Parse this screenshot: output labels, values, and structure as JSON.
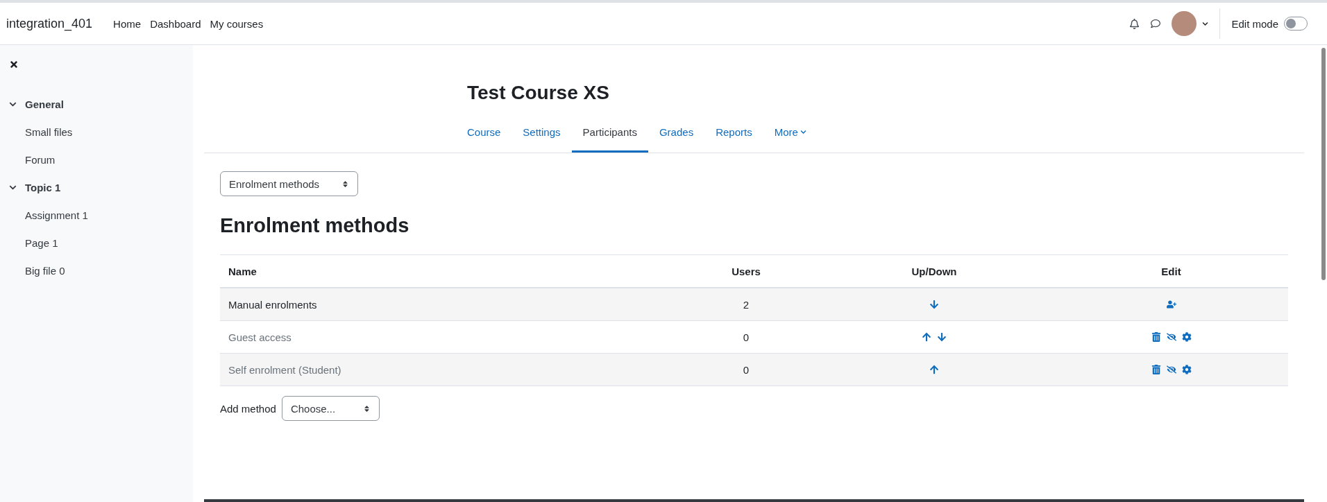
{
  "navbar": {
    "brand": "integration_401",
    "links": [
      "Home",
      "Dashboard",
      "My courses"
    ],
    "edit_mode": {
      "label": "Edit mode",
      "on": false
    }
  },
  "sidebar": {
    "sections": [
      {
        "title": "General",
        "expanded": true,
        "children": [
          {
            "label": "Small files"
          },
          {
            "label": "Forum"
          }
        ]
      },
      {
        "title": "Topic 1",
        "expanded": true,
        "children": [
          {
            "label": "Assignment 1"
          },
          {
            "label": "Page 1"
          },
          {
            "label": "Big file 0"
          }
        ]
      }
    ]
  },
  "course": {
    "title": "Test Course XS",
    "tabs": [
      {
        "label": "Course",
        "selected": false
      },
      {
        "label": "Settings",
        "selected": false
      },
      {
        "label": "Participants",
        "selected": true
      },
      {
        "label": "Grades",
        "selected": false
      },
      {
        "label": "Reports",
        "selected": false
      },
      {
        "label": "More",
        "selected": false,
        "kind": "dropdown"
      }
    ]
  },
  "page_select": {
    "value": "Enrolment methods"
  },
  "heading": "Enrolment methods",
  "table": {
    "columns": [
      "Name",
      "Users",
      "Up/Down",
      "Edit"
    ],
    "rows": [
      {
        "name": "Manual enrolments",
        "users": "2",
        "enabled": true,
        "move": [
          {
            "kind": "down"
          }
        ],
        "actions": [
          {
            "kind": "enrol"
          }
        ]
      },
      {
        "name": "Guest access",
        "users": "0",
        "enabled": false,
        "move": [
          {
            "kind": "up"
          },
          {
            "kind": "down"
          }
        ],
        "actions": [
          {
            "kind": "delete"
          },
          {
            "kind": "hide"
          },
          {
            "kind": "settings"
          }
        ]
      },
      {
        "name": "Self enrolment (Student)",
        "users": "0",
        "enabled": false,
        "move": [
          {
            "kind": "up"
          }
        ],
        "actions": [
          {
            "kind": "delete"
          },
          {
            "kind": "hide"
          },
          {
            "kind": "settings"
          }
        ]
      }
    ]
  },
  "add_method": {
    "label": "Add method",
    "value": "Choose..."
  }
}
